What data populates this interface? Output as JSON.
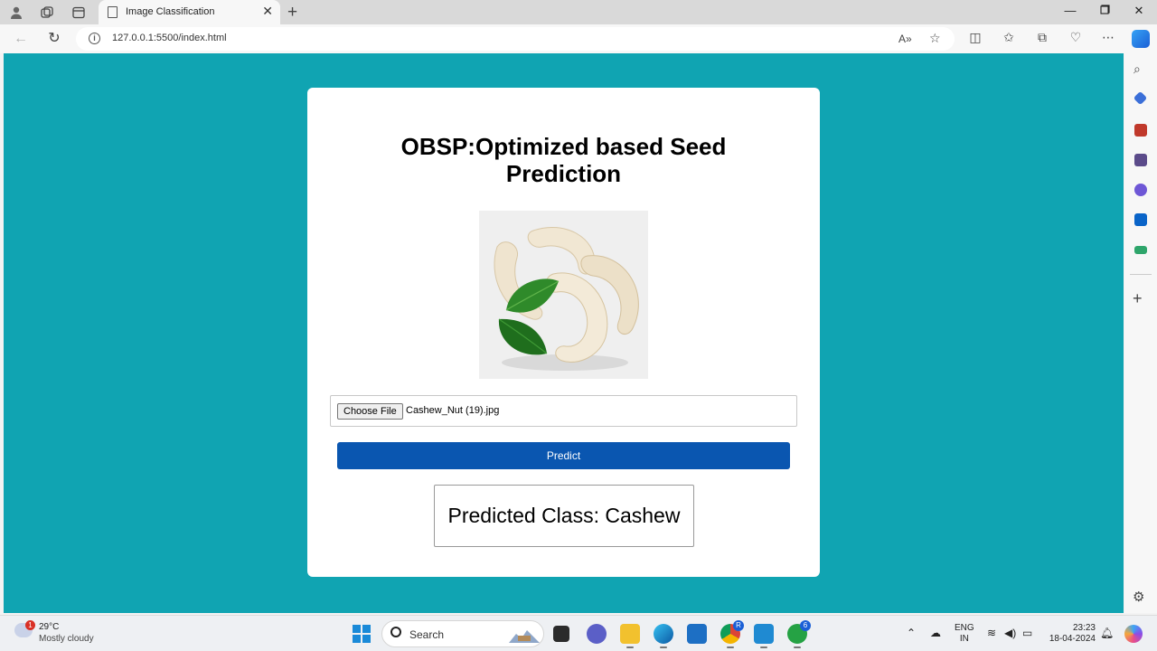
{
  "browser": {
    "tab_title": "Image Classification",
    "url": "127.0.0.1:5500/index.html"
  },
  "page": {
    "heading": "OBSP:Optimized based Seed Prediction",
    "choose_file_label": "Choose File",
    "file_name": "Cashew_Nut (19).jpg",
    "predict_label": "Predict",
    "result_text": "Predicted Class: Cashew",
    "preview_image": "cashew-nuts-with-green-leaves",
    "colors": {
      "background": "#10a4b2",
      "predict_button": "#0a56b0"
    }
  },
  "taskbar": {
    "weather_temp": "29°C",
    "weather_desc": "Mostly cloudy",
    "weather_badge": "1",
    "search_label": "Search",
    "chrome_badge": "R",
    "whatsapp_badge": "6",
    "lang_1": "ENG",
    "lang_2": "IN",
    "time": "23:23",
    "date": "18-04-2024"
  }
}
